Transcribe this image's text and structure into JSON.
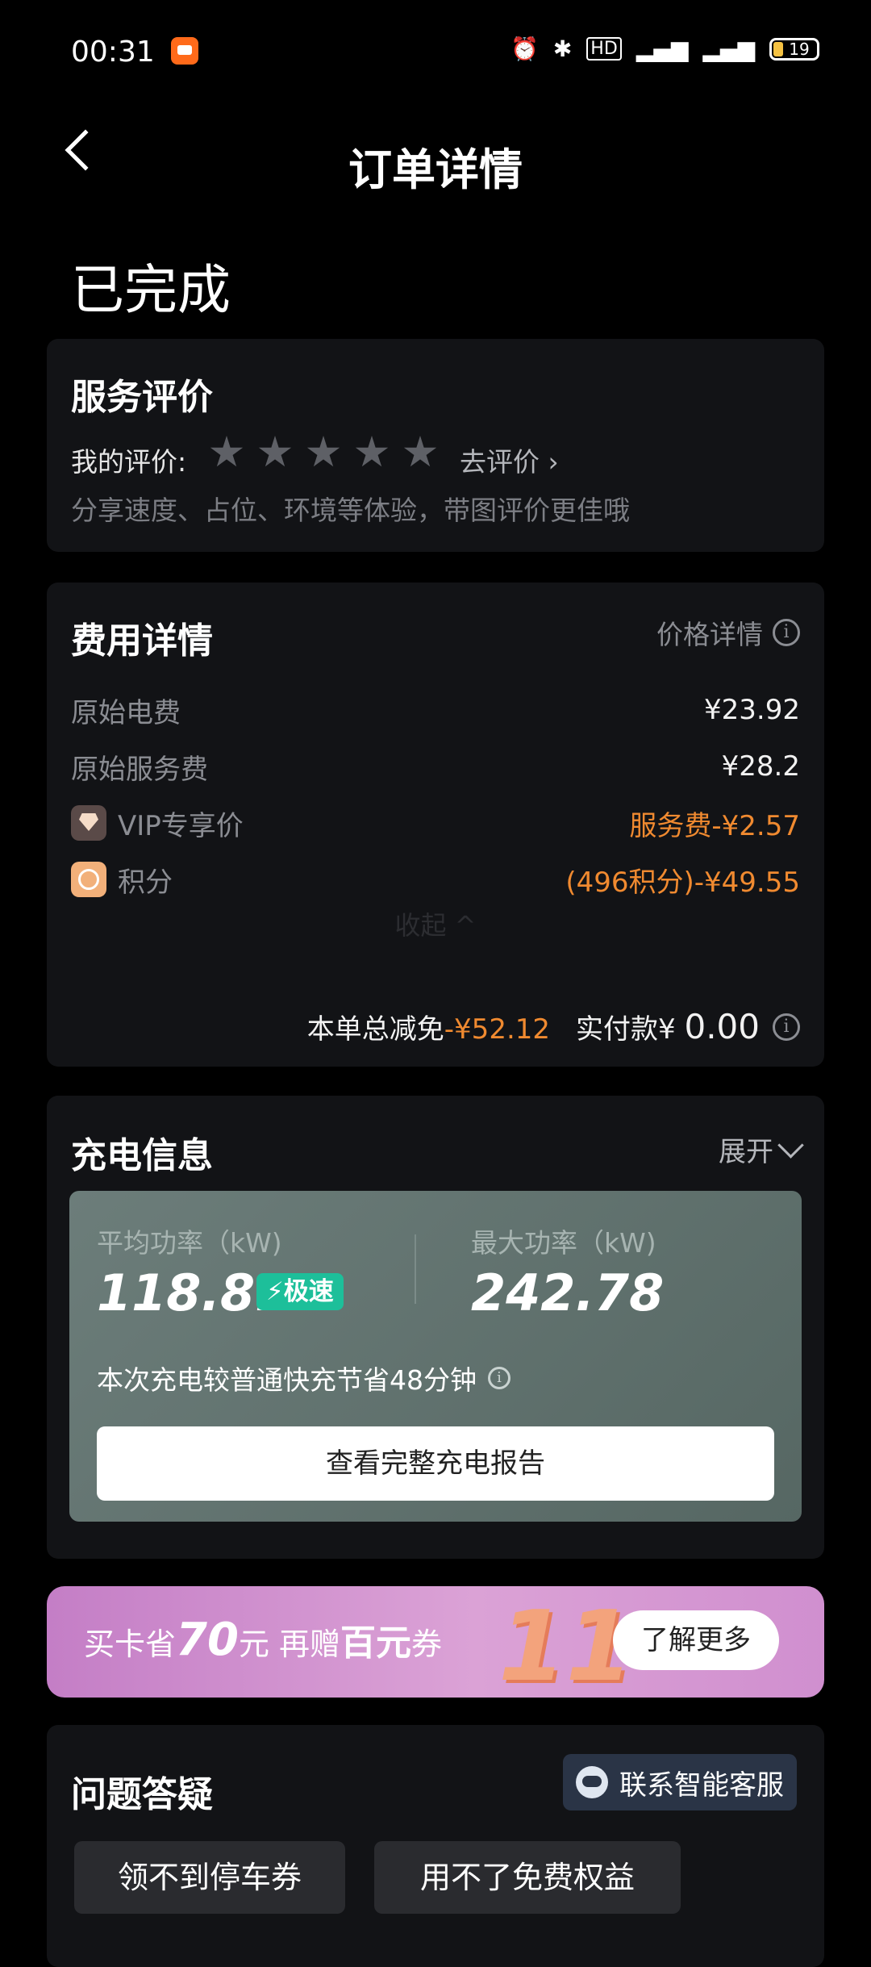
{
  "status_bar": {
    "time": "00:31",
    "battery": "19",
    "icons": [
      "alarm-icon",
      "bluetooth-icon",
      "hd-icon",
      "signal-4g-icon",
      "signal-4g-icon"
    ]
  },
  "header": {
    "title": "订单详情"
  },
  "order_status": "已完成",
  "rating": {
    "title": "服务评价",
    "label": "我的评价:",
    "stars": 5,
    "action": "去评价 ›",
    "hint": "分享速度、占位、环境等体验，带图评价更佳哦"
  },
  "fees": {
    "title": "费用详情",
    "price_detail_label": "价格详情",
    "rows": [
      {
        "label": "原始电费",
        "value": "¥23.92"
      },
      {
        "label": "原始服务费",
        "value": "¥28.2"
      },
      {
        "label": "VIP专享价",
        "value": "服务费-¥2.57"
      },
      {
        "label": "积分",
        "value": "(496积分)-¥49.55"
      }
    ],
    "collapse_label": "收起 ^",
    "total_discount_label": "本单总减免",
    "total_discount_value": "-¥52.12",
    "paid_label": "实付款¥",
    "paid_value": "0.00"
  },
  "charge": {
    "title": "充电信息",
    "expand_label": "展开",
    "avg_power_label": "平均功率（kW)",
    "avg_power_value": "118.81",
    "fast_badge": "⚡极速",
    "max_power_label": "最大功率（kW)",
    "max_power_value": "242.78",
    "saving_text": "本次充电较普通快充节省48分钟",
    "report_button": "查看完整充电报告"
  },
  "promo": {
    "text_1": "买卡省",
    "amount": "70",
    "text_2": "元 再赠",
    "text_3": "百元",
    "text_4": "券",
    "art": "11",
    "button": "了解更多"
  },
  "faq": {
    "title": "问题答疑",
    "cs_button": "联系智能客服",
    "chips": [
      "领不到停车券",
      "用不了免费权益"
    ]
  },
  "colors": {
    "accent_orange": "#f08a30",
    "fast_green": "#1dbf9a",
    "card_bg": "#121316"
  }
}
